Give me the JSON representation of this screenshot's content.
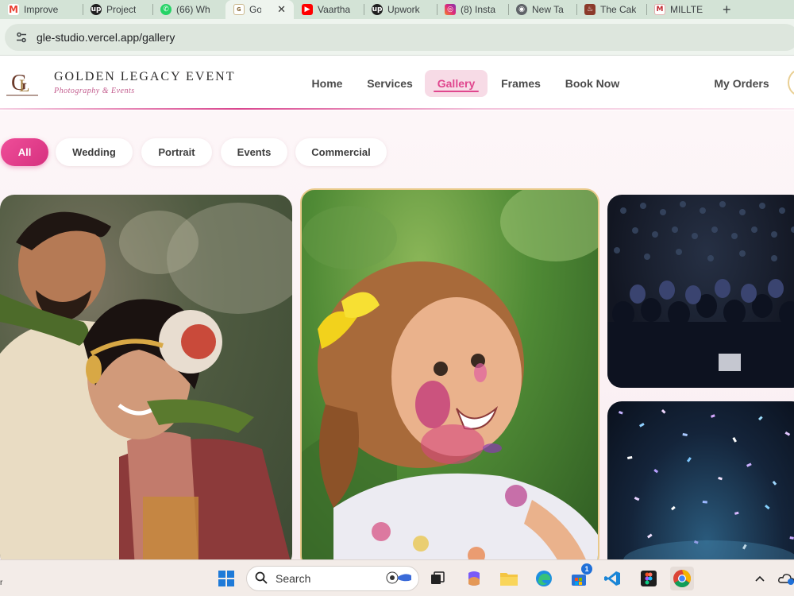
{
  "browser": {
    "tabs": [
      {
        "label": "Improve",
        "favicon": "gmail-icon",
        "color": "#ea4335",
        "glyph": "M"
      },
      {
        "label": "Project",
        "favicon": "upwork-icon",
        "color": "#1f1f1f",
        "glyph": "up"
      },
      {
        "label": "(66) Wh",
        "favicon": "whatsapp-icon",
        "color": "#25d366",
        "glyph": "✆"
      },
      {
        "label": "Gol",
        "favicon": "golden-legacy-icon",
        "color": "#8a6a3a",
        "glyph": "ɢ"
      },
      {
        "label": "Vaartha",
        "favicon": "youtube-icon",
        "color": "#ff0000",
        "glyph": "▶"
      },
      {
        "label": "Upwork",
        "favicon": "upwork-icon",
        "color": "#1f1f1f",
        "glyph": "up"
      },
      {
        "label": "(8) Insta",
        "favicon": "instagram-icon",
        "color": "#d6247b",
        "glyph": "◎"
      },
      {
        "label": "New Ta",
        "favicon": "chrome-icon",
        "color": "#5f6368",
        "glyph": "◉"
      },
      {
        "label": "The Cak",
        "favicon": "cake-icon",
        "color": "#8b3a2a",
        "glyph": "♨"
      },
      {
        "label": "MILLTE",
        "favicon": "milltec-icon",
        "color": "#c0272d",
        "glyph": "M"
      }
    ],
    "active_tab_close": "✕",
    "new_tab": "+",
    "url": "gle-studio.vercel.app/gallery"
  },
  "site": {
    "brand_name": "GOLDEN LEGACY EVENT",
    "brand_tagline": "Photography & Events",
    "nav": [
      "Home",
      "Services",
      "Gallery",
      "Frames",
      "Book Now"
    ],
    "active_nav": "Gallery",
    "my_orders": "My Orders",
    "accent_color": "#e0468e"
  },
  "gallery": {
    "filters": [
      "All",
      "Wedding",
      "Portrait",
      "Events",
      "Commercial"
    ],
    "active_filter": "All"
  },
  "taskbar": {
    "search_placeholder": "Search",
    "store_badge": "1"
  }
}
